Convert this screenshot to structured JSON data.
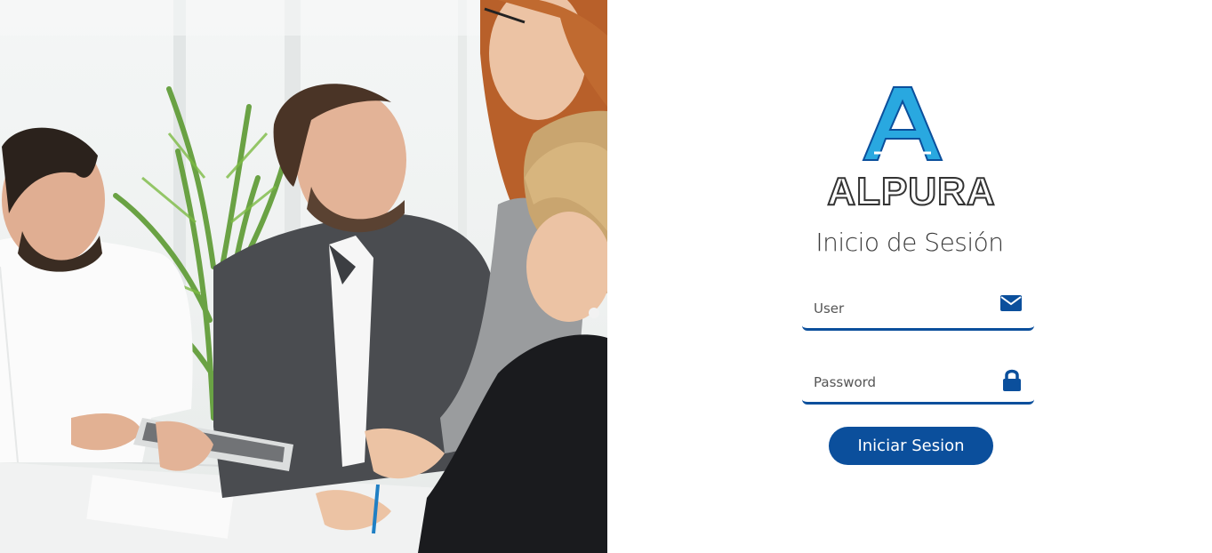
{
  "brand": {
    "logo_letter": "A",
    "name": "ALPURA",
    "color_blue": "#0b4f9c",
    "color_light_blue": "#29a8e0"
  },
  "login": {
    "title": "Inicio de Sesión",
    "user_placeholder": "User",
    "password_placeholder": "Password",
    "submit_label": "Iniciar Sesion"
  },
  "icons": {
    "user": "envelope-icon",
    "password": "lock-icon"
  }
}
